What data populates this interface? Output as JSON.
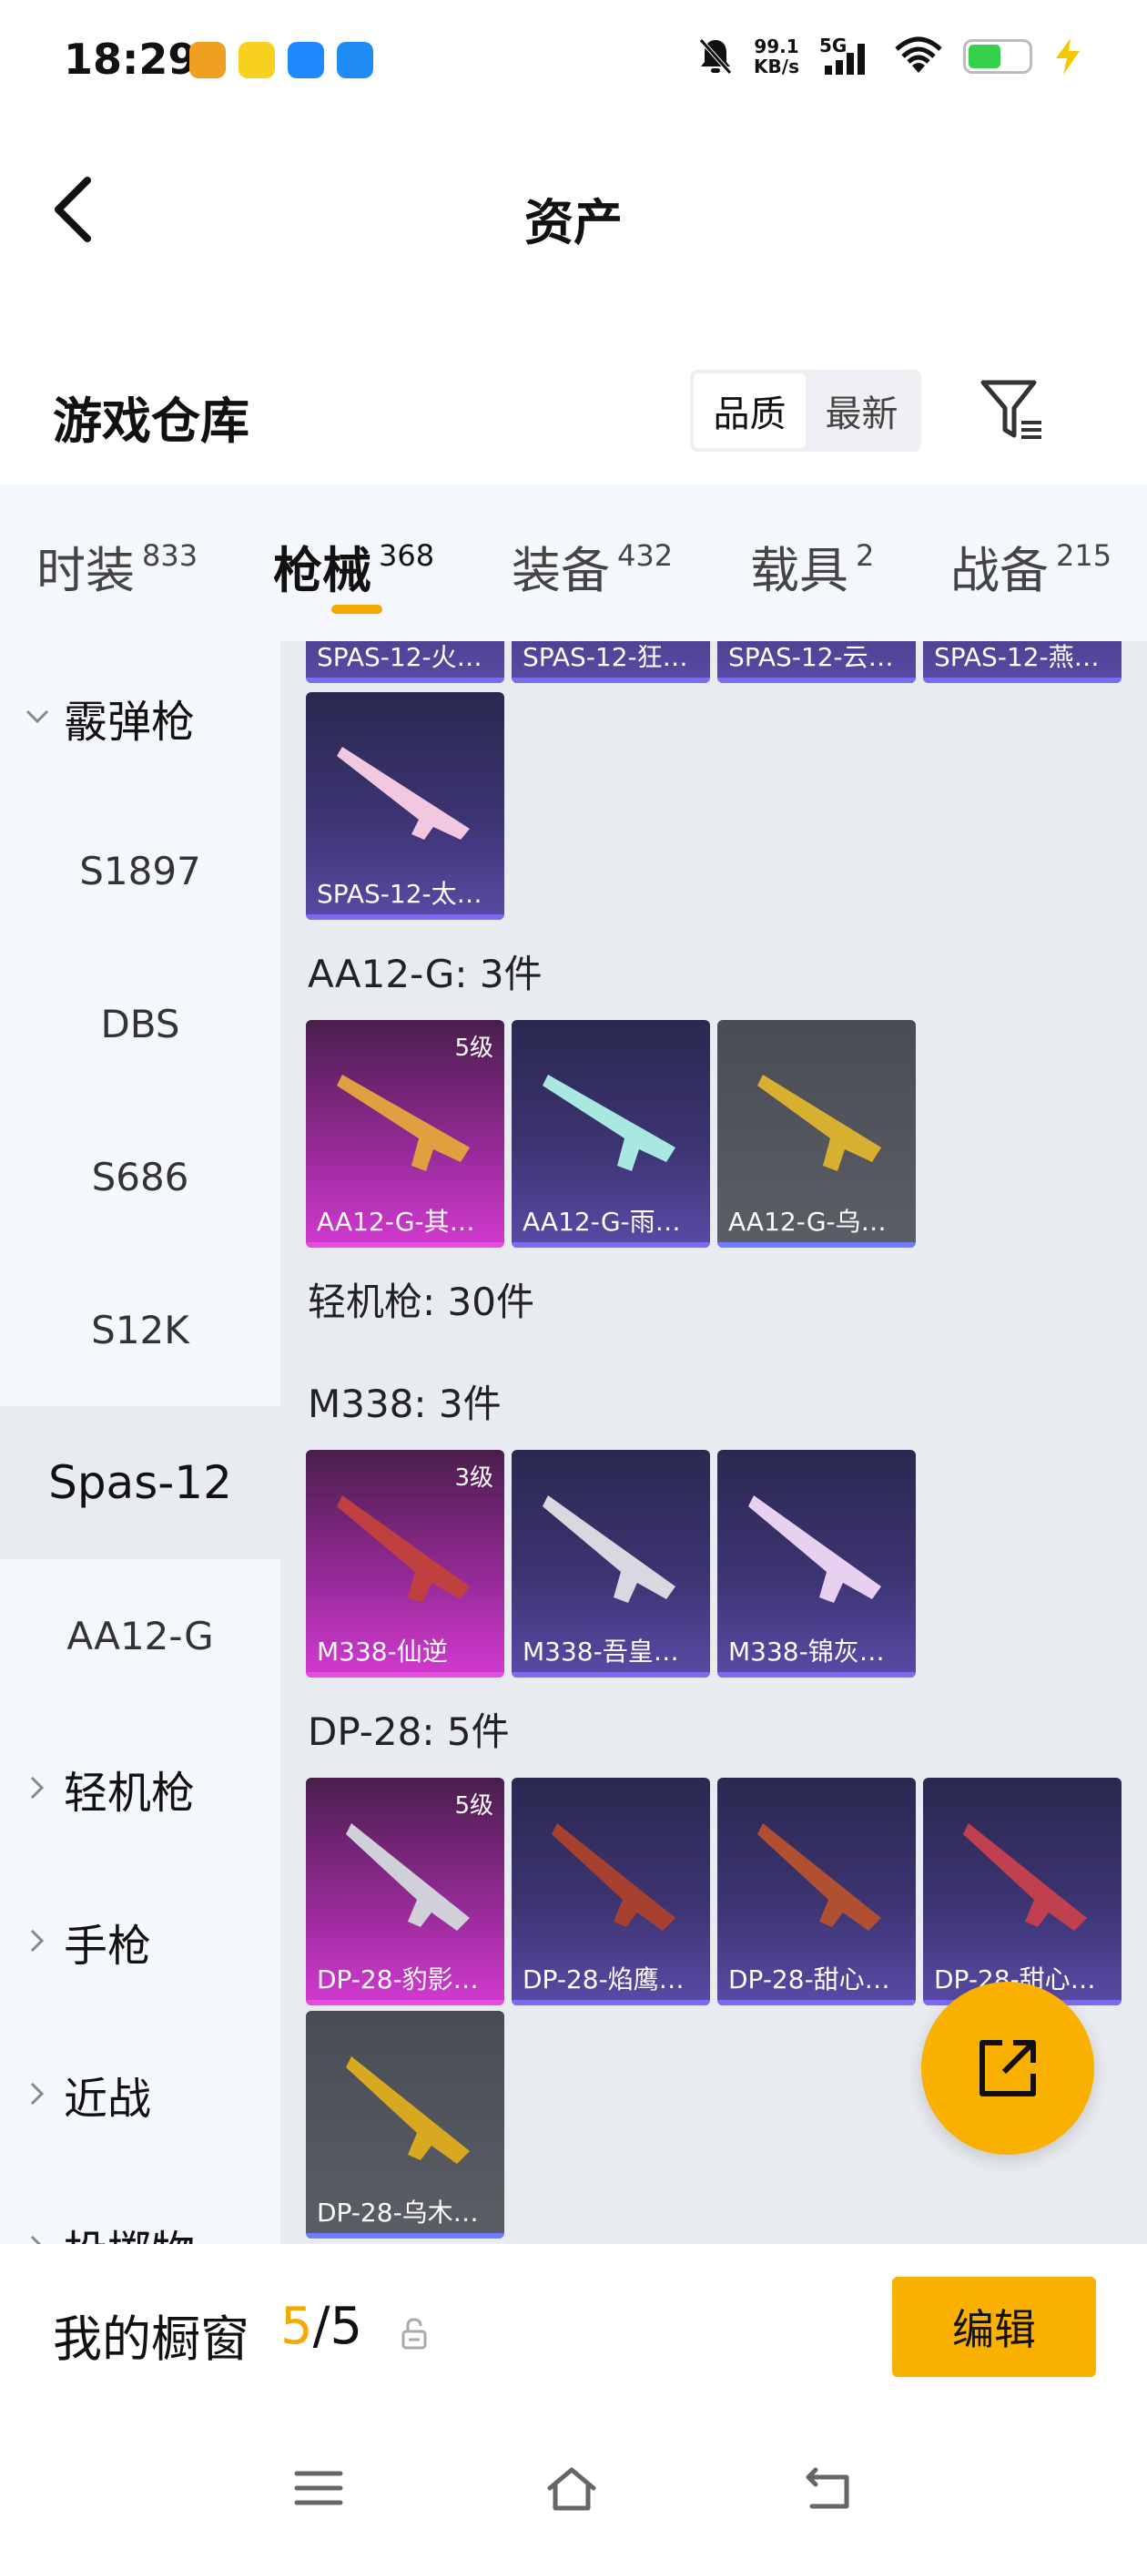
{
  "status_bar": {
    "time": "18:29",
    "net_speed_value": "99.1",
    "net_speed_unit": "KB/s",
    "network_type": "5G",
    "battery_level": 0.55,
    "app_icons": [
      {
        "name": "game-app-icon",
        "color": "#f0a020"
      },
      {
        "name": "sunny-app-icon",
        "color": "#f8d020"
      },
      {
        "name": "du-app-icon",
        "color": "#1e88ff"
      },
      {
        "name": "cloud-app-icon",
        "color": "#1f8cf5"
      }
    ]
  },
  "header": {
    "title": "资产"
  },
  "section": {
    "title": "游戏仓库",
    "sort_options": [
      "品质",
      "最新"
    ],
    "sort_active": 0
  },
  "categories": [
    {
      "label": "时装",
      "count": "833"
    },
    {
      "label": "枪械",
      "count": "368",
      "active": true
    },
    {
      "label": "装备",
      "count": "432"
    },
    {
      "label": "载具",
      "count": "2"
    },
    {
      "label": "战备",
      "count": "215"
    }
  ],
  "side_nav": {
    "items": [
      {
        "label": "霰弹枪",
        "type": "group",
        "expanded": true
      },
      {
        "label": "S1897",
        "type": "sub"
      },
      {
        "label": "DBS",
        "type": "sub"
      },
      {
        "label": "S686",
        "type": "sub"
      },
      {
        "label": "S12K",
        "type": "sub"
      },
      {
        "label": "Spas-12",
        "type": "sub",
        "active": true
      },
      {
        "label": "AA12-G",
        "type": "sub"
      },
      {
        "label": "轻机枪",
        "type": "group",
        "expanded": false
      },
      {
        "label": "手枪",
        "type": "group",
        "expanded": false
      },
      {
        "label": "近战",
        "type": "group",
        "expanded": false
      },
      {
        "label": "投掷物",
        "type": "group",
        "expanded": false
      }
    ]
  },
  "content": {
    "top_partial_items": [
      {
        "name": "SPAS-12-火…",
        "rarity": "purple"
      },
      {
        "name": "SPAS-12-狂…",
        "rarity": "purple"
      },
      {
        "name": "SPAS-12-云…",
        "rarity": "purple"
      },
      {
        "name": "SPAS-12-燕…",
        "rarity": "purple"
      }
    ],
    "spas_extra": [
      {
        "name": "SPAS-12-太…",
        "rarity": "purple",
        "gun_color": "#f2c8e0"
      }
    ],
    "aa12_group": {
      "label": "AA12-G: 3件",
      "items": [
        {
          "name": "AA12-G-其…",
          "rarity": "pink",
          "level": "5级",
          "gun_color": "#e0a040"
        },
        {
          "name": "AA12-G-雨…",
          "rarity": "purple",
          "gun_color": "#a8e8e0"
        },
        {
          "name": "AA12-G-乌…",
          "rarity": "gray",
          "gun_color": "#d8b030"
        }
      ]
    },
    "lmg_header": "轻机枪: 30件",
    "m338_group": {
      "label": "M338: 3件",
      "items": [
        {
          "name": "M338-仙逆",
          "rarity": "pink",
          "level": "3级",
          "gun_color": "#c04040"
        },
        {
          "name": "M338-吾皇…",
          "rarity": "purple",
          "gun_color": "#d8d8e0"
        },
        {
          "name": "M338-锦灰…",
          "rarity": "purple",
          "gun_color": "#e8d0f0"
        }
      ]
    },
    "dp28_group": {
      "label": "DP-28: 5件",
      "items": [
        {
          "name": "DP-28-豹影…",
          "rarity": "pink",
          "level": "5级",
          "gun_color": "#d0d0d8"
        },
        {
          "name": "DP-28-焰鹰…",
          "rarity": "purple",
          "gun_color": "#a84030"
        },
        {
          "name": "DP-28-甜心…",
          "rarity": "purple",
          "gun_color": "#b05030"
        },
        {
          "name": "DP-28-甜心…",
          "rarity": "purple",
          "gun_color": "#c04050"
        },
        {
          "name": "DP-28-乌木…",
          "rarity": "gray",
          "gun_color": "#d8a820"
        }
      ]
    }
  },
  "showcase": {
    "label": "我的橱窗",
    "current": "5",
    "separator": "/",
    "total": "5",
    "edit_label": "编辑"
  },
  "colors": {
    "accent": "#f5a800",
    "purple_rarity": "#5a4aa6",
    "pink_rarity": "#d23ad0",
    "gray_rarity": "#5c5e66"
  }
}
